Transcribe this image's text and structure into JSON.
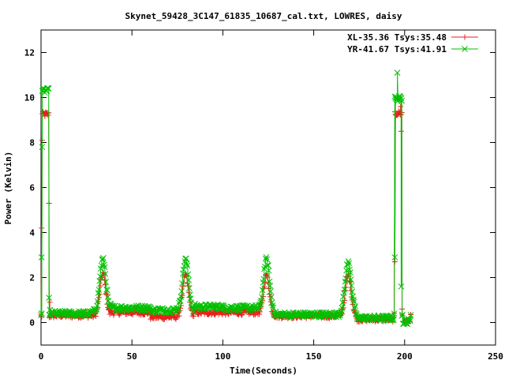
{
  "chart_data": {
    "type": "scatter",
    "title": "Skynet_59428_3C147_61835_10687_cal.txt, LOWRES, daisy",
    "xlabel": "Time(Seconds)",
    "ylabel": "Power (Kelvin)",
    "xlim": [
      0,
      250
    ],
    "ylim": [
      -1,
      13
    ],
    "xticks": [
      0,
      50,
      100,
      150,
      200,
      250
    ],
    "yticks": [
      0,
      2,
      4,
      6,
      8,
      10,
      12
    ],
    "grid": false,
    "legend_position": "top-right",
    "series": [
      {
        "name": "XL-35.36 Tsys:35.48",
        "color": "#e8211c",
        "marker": "+",
        "baseline": 0.3,
        "noise": 0.12,
        "cal_levels": [
          {
            "x0": 0.4,
            "x1": 4.5,
            "y": 9.25
          },
          {
            "x0": 194.5,
            "x1": 198.5,
            "y": 9.3
          }
        ],
        "spikes": [
          {
            "x": 0.3,
            "y": 4.2
          },
          {
            "x": 0.6,
            "y": 8.1
          },
          {
            "x": 4.4,
            "y": 5.3
          },
          {
            "x": 4.8,
            "y": 0.9
          },
          {
            "x": 194.6,
            "y": 2.7
          },
          {
            "x": 197.8,
            "y": 9.6
          },
          {
            "x": 198.1,
            "y": 8.5
          },
          {
            "x": 198.6,
            "y": 0.6
          }
        ],
        "peaks": [
          {
            "x": 34,
            "y": 2.2,
            "w": 1.6
          },
          {
            "x": 79.5,
            "y": 2.1,
            "w": 1.6
          },
          {
            "x": 124,
            "y": 2.1,
            "w": 1.6
          },
          {
            "x": 169,
            "y": 2.1,
            "w": 1.6
          }
        ],
        "segments": [
          {
            "x0": 5,
            "x1": 28,
            "y": 0.32
          },
          {
            "x0": 38,
            "x1": 60,
            "y": 0.45
          },
          {
            "x0": 60,
            "x1": 76,
            "y": 0.25
          },
          {
            "x0": 84,
            "x1": 100,
            "y": 0.45
          },
          {
            "x0": 100,
            "x1": 120,
            "y": 0.45
          },
          {
            "x0": 128,
            "x1": 165,
            "y": 0.3
          },
          {
            "x0": 173,
            "x1": 194,
            "y": 0.15
          },
          {
            "x0": 199,
            "x1": 203,
            "y": 0.05
          }
        ]
      },
      {
        "name": "YR-41.67 Tsys:41.91",
        "color": "#00c000",
        "marker": "x",
        "baseline": 0.45,
        "noise": 0.12,
        "cal_levels": [
          {
            "x0": 0.4,
            "x1": 4.5,
            "y": 10.3
          },
          {
            "x0": 194.5,
            "x1": 198.5,
            "y": 9.95
          }
        ],
        "spikes": [
          {
            "x": 0.3,
            "y": 2.9
          },
          {
            "x": 0.6,
            "y": 7.8
          },
          {
            "x": 4.4,
            "y": 1.1
          },
          {
            "x": 194.6,
            "y": 2.9
          },
          {
            "x": 196.0,
            "y": 11.1
          },
          {
            "x": 198.1,
            "y": 1.6
          },
          {
            "x": 198.6,
            "y": 0.3
          }
        ],
        "peaks": [
          {
            "x": 34,
            "y": 2.8,
            "w": 1.7
          },
          {
            "x": 79.5,
            "y": 2.8,
            "w": 1.7
          },
          {
            "x": 124,
            "y": 2.8,
            "w": 1.7
          },
          {
            "x": 169,
            "y": 2.65,
            "w": 1.7
          }
        ],
        "segments": [
          {
            "x0": 5,
            "x1": 28,
            "y": 0.4
          },
          {
            "x0": 38,
            "x1": 60,
            "y": 0.65
          },
          {
            "x0": 60,
            "x1": 76,
            "y": 0.55
          },
          {
            "x0": 84,
            "x1": 100,
            "y": 0.7
          },
          {
            "x0": 100,
            "x1": 120,
            "y": 0.65
          },
          {
            "x0": 128,
            "x1": 165,
            "y": 0.35
          },
          {
            "x0": 173,
            "x1": 194,
            "y": 0.2
          },
          {
            "x0": 199,
            "x1": 203,
            "y": 0.05
          }
        ]
      }
    ]
  }
}
